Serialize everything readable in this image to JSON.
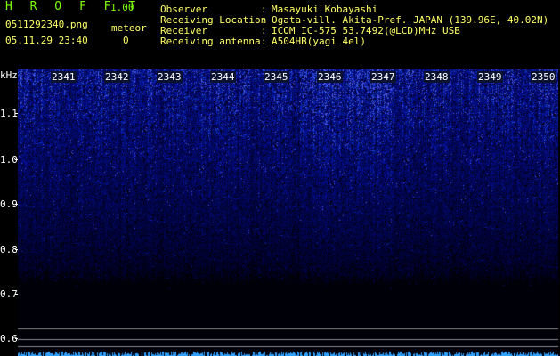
{
  "app": {
    "title": "H R O F F T",
    "version": "1.00"
  },
  "file": {
    "name": "0511292340.png",
    "timestamp": "05.11.29 23:40"
  },
  "meteor": {
    "label": "meteor",
    "count": "0"
  },
  "info": [
    {
      "label": "Observer",
      "value": "Masayuki Kobayashi"
    },
    {
      "label": "Receiving Location",
      "value": "Ogata-vill. Akita-Pref. JAPAN (139.96E, 40.02N)"
    },
    {
      "label": "Receiver",
      "value": "ICOM IC-575 53.7492(@LCD)MHz USB"
    },
    {
      "label": "Receiving antenna",
      "value": "A504HB(yagi 4el)"
    }
  ],
  "yaxis": {
    "unit": "kHz",
    "ticks": [
      "1.1",
      "1.0",
      "0.9",
      "0.8",
      "0.7",
      "0.6"
    ]
  },
  "columns": [
    "2341",
    "2342",
    "2343",
    "2344",
    "2345",
    "2346",
    "2347",
    "2348",
    "2349",
    "2350"
  ],
  "colors": {
    "bg": "#000000",
    "signal": "#2040d0",
    "bright": "#40c0ff",
    "label_green": "#7cfc00",
    "label_yellow": "#ffff66"
  }
}
